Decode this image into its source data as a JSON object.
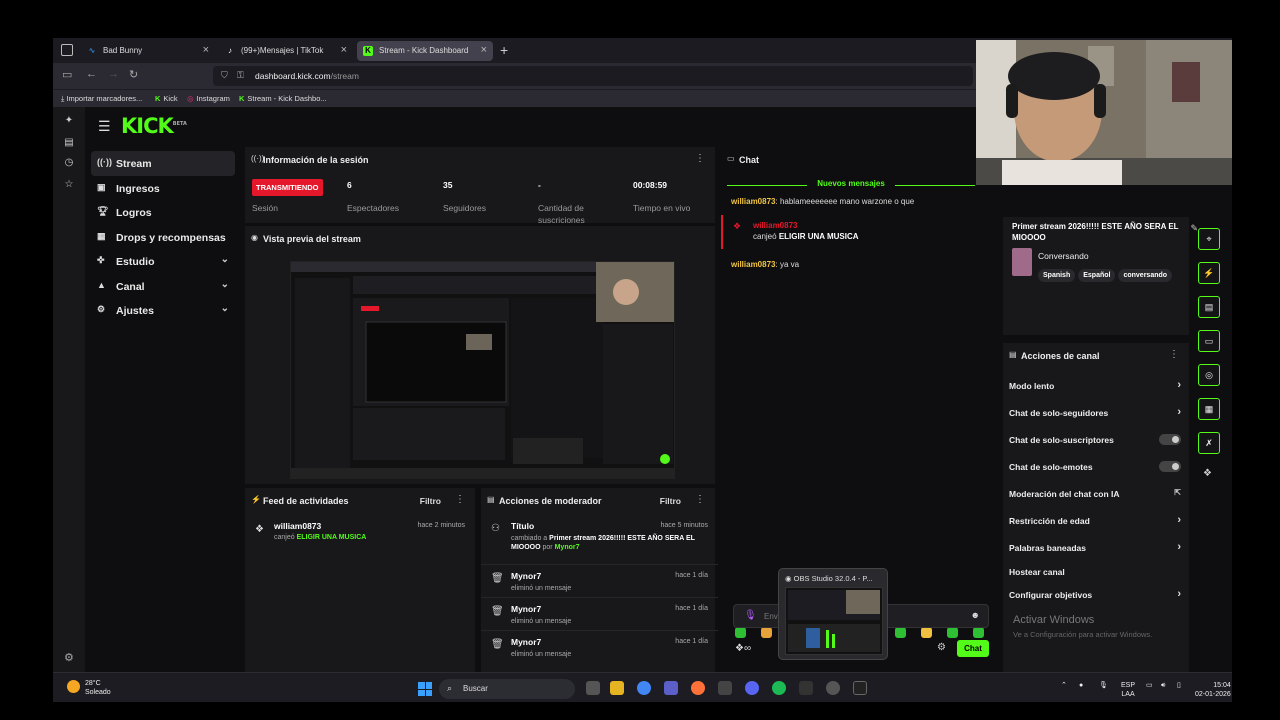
{
  "browser": {
    "tabs": [
      {
        "title": "Bad Bunny",
        "icon": "soundwave-icon",
        "active": false
      },
      {
        "title": "(99+)Mensajes | TikTok",
        "icon": "tiktok-icon",
        "active": false
      },
      {
        "title": "Stream - Kick Dashboard",
        "icon": "kick-icon",
        "active": true
      }
    ],
    "url_domain": "dashboard.kick.com",
    "url_path": "/stream",
    "bookmarks": [
      "Importar marcadores...",
      "Kick",
      "Instagram",
      "Stream - Kick Dashbo..."
    ]
  },
  "kick": {
    "logo": "KICK",
    "logo_badge": "BETA",
    "accent": "#53fc18",
    "nav": [
      {
        "label": "Stream",
        "icon": "broadcast-icon",
        "active": true,
        "chevron": false
      },
      {
        "label": "Ingresos",
        "icon": "revenue-icon",
        "active": false,
        "chevron": false
      },
      {
        "label": "Logros",
        "icon": "trophy-icon",
        "active": false,
        "chevron": false
      },
      {
        "label": "Drops y recompensas",
        "icon": "gift-icon",
        "active": false,
        "chevron": false
      },
      {
        "label": "Estudio",
        "icon": "studio-icon",
        "active": false,
        "chevron": true
      },
      {
        "label": "Canal",
        "icon": "channel-icon",
        "active": false,
        "chevron": true
      },
      {
        "label": "Ajustes",
        "icon": "gear-icon",
        "active": false,
        "chevron": true
      }
    ]
  },
  "session": {
    "title": "Información de la sesión",
    "badge": "TRANSMITIENDO",
    "badge_label": "Sesión",
    "stats": [
      {
        "value": "6",
        "label": "Espectadores"
      },
      {
        "value": "35",
        "label": "Seguidores"
      },
      {
        "value": "-",
        "label": "Cantidad de suscriciones"
      },
      {
        "value": "00:08:59",
        "label": "Tiempo en vivo"
      }
    ]
  },
  "preview": {
    "title": "Vista previa del stream"
  },
  "activity": {
    "title": "Feed de actividades",
    "filter": "Filtro",
    "items": [
      {
        "user": "william0873",
        "action": "canjeó",
        "reward": "ELIGIR UNA MUSICA",
        "time": "hace 2 minutos"
      }
    ]
  },
  "moderator": {
    "title": "Acciones de moderador",
    "filter": "Filtro",
    "items": [
      {
        "user": "Título",
        "line1": "cambiado a",
        "bold": "Primer stream 2026!!!!! ESTE AÑO SERA EL MIOOOO",
        "by": "por",
        "by_user": "Mynor7",
        "time": "hace 5 minutos",
        "icon": "users-icon"
      },
      {
        "user": "Mynor7",
        "line1": "eliminó un mensaje",
        "time": "hace 1 día",
        "icon": "trash-icon"
      },
      {
        "user": "Mynor7",
        "line1": "eliminó un mensaje",
        "time": "hace 1 día",
        "icon": "trash-icon"
      },
      {
        "user": "Mynor7",
        "line1": "eliminó un mensaje",
        "time": "hace 1 día",
        "icon": "trash-icon"
      }
    ]
  },
  "chat": {
    "title": "Chat",
    "new_messages": "Nuevos mensajes",
    "messages": [
      {
        "user": "william0873",
        "text": "hablameeeeeee mano warzone o que"
      },
      {
        "user": "william0873",
        "text": "canjeó",
        "reward": "ELIGIR UNA MUSICA",
        "redeem": true
      },
      {
        "user": "william0873",
        "text": "ya va"
      }
    ],
    "input_placeholder": "Env",
    "send_label": "Chat"
  },
  "stream_info": {
    "title": "Primer stream 2026!!!!! ESTE AÑO SERA EL MIOOOO",
    "category": "Conversando",
    "tags": [
      "Spanish",
      "Español",
      "conversando"
    ]
  },
  "channel_actions": {
    "title": "Acciones de canal",
    "rows": [
      {
        "label": "Modo lento",
        "kind": "chevron"
      },
      {
        "label": "Chat de solo-seguidores",
        "kind": "chevron"
      },
      {
        "label": "Chat de solo-suscriptores",
        "kind": "toggle"
      },
      {
        "label": "Chat de solo-emotes",
        "kind": "toggle"
      },
      {
        "label": "Moderación del chat con IA",
        "kind": "external"
      },
      {
        "label": "Restricción de edad",
        "kind": "chevron"
      },
      {
        "label": "Palabras baneadas",
        "kind": "chevron"
      },
      {
        "label": "Hostear canal",
        "kind": "none"
      },
      {
        "label": "Configurar objetivos",
        "kind": "chevron"
      }
    ]
  },
  "windows": {
    "activate_title": "Activar Windows",
    "activate_sub": "Ve a Configuración para activar Windows.",
    "obs_popup": "OBS Studio 32.0.4 - P...",
    "weather_temp": "28°C",
    "weather_desc": "Soleado",
    "search": "Buscar",
    "lang": "ESP",
    "lang2": "LAA",
    "time": "15:04",
    "date": "02-01-2026"
  }
}
